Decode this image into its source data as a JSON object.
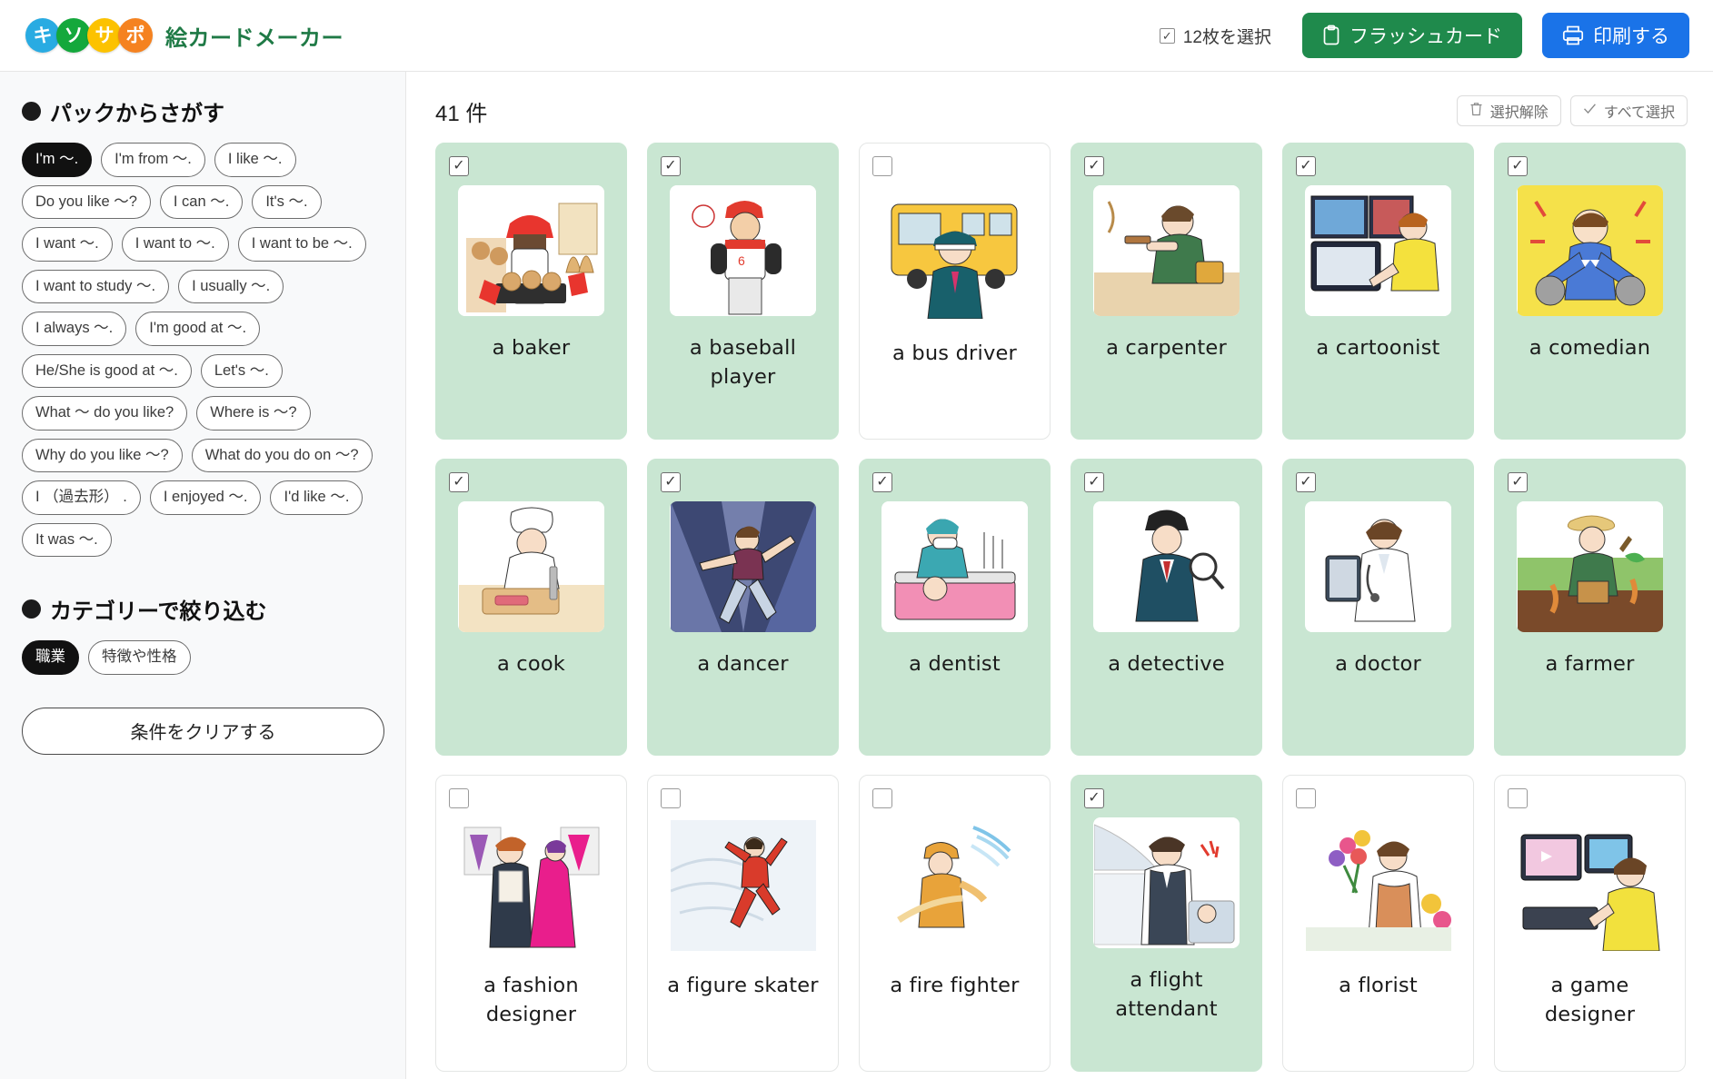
{
  "header": {
    "logo_letters": [
      "キ",
      "ソ",
      "サ",
      "ポ"
    ],
    "app_title": "絵カードメーカー",
    "selection_label": "12枚を選択",
    "selection_check_icon": "✓",
    "flashcard_button": "フラッシュカード",
    "print_button": "印刷する",
    "colors": {
      "logo_blue": "#29abe2",
      "logo_green": "#14a83c",
      "logo_yellow": "#fcc200",
      "logo_orange": "#f58220",
      "title_green": "#1f7a46",
      "flashcard_green": "#1f8a4c",
      "print_blue": "#1a73e8"
    }
  },
  "sidebar": {
    "pack_heading": "パックからさがす",
    "pack_tags": [
      {
        "label": "I'm 〜.",
        "active": true
      },
      {
        "label": "I'm from 〜.",
        "active": false
      },
      {
        "label": "I like 〜.",
        "active": false
      },
      {
        "label": "Do you like 〜?",
        "active": false
      },
      {
        "label": "I can 〜.",
        "active": false
      },
      {
        "label": "It's 〜.",
        "active": false
      },
      {
        "label": "I want 〜.",
        "active": false
      },
      {
        "label": "I want to 〜.",
        "active": false
      },
      {
        "label": "I want to be 〜.",
        "active": false
      },
      {
        "label": "I want to study 〜.",
        "active": false
      },
      {
        "label": "I usually 〜.",
        "active": false
      },
      {
        "label": "I always 〜.",
        "active": false
      },
      {
        "label": "I'm good at 〜.",
        "active": false
      },
      {
        "label": "He/She is good at 〜.",
        "active": false
      },
      {
        "label": "Let's 〜.",
        "active": false
      },
      {
        "label": "What 〜 do you like?",
        "active": false
      },
      {
        "label": "Where is 〜?",
        "active": false
      },
      {
        "label": "Why do you like 〜?",
        "active": false
      },
      {
        "label": "What do you do on 〜?",
        "active": false
      },
      {
        "label": "I （過去形） .",
        "active": false
      },
      {
        "label": "I enjoyed 〜.",
        "active": false
      },
      {
        "label": "I'd like 〜.",
        "active": false
      },
      {
        "label": "It was 〜.",
        "active": false
      }
    ],
    "category_heading": "カテゴリーで絞り込む",
    "category_tags": [
      {
        "label": "職業",
        "active": true
      },
      {
        "label": "特徴や性格",
        "active": false
      }
    ],
    "clear_button": "条件をクリアする"
  },
  "main": {
    "result_count": "41 件",
    "deselect_button": "選択解除",
    "deselect_icon": "trash-icon",
    "select_all_button": "すべて選択",
    "select_all_icon": "check-icon",
    "cards": [
      {
        "label": "a baker",
        "selected": true,
        "art": "baker"
      },
      {
        "label": "a baseball player",
        "selected": true,
        "art": "baseball"
      },
      {
        "label": "a bus driver",
        "selected": false,
        "art": "busdriver"
      },
      {
        "label": "a carpenter",
        "selected": true,
        "art": "carpenter"
      },
      {
        "label": "a cartoonist",
        "selected": true,
        "art": "cartoonist"
      },
      {
        "label": "a comedian",
        "selected": true,
        "art": "comedian"
      },
      {
        "label": "a cook",
        "selected": true,
        "art": "cook"
      },
      {
        "label": "a dancer",
        "selected": true,
        "art": "dancer"
      },
      {
        "label": "a dentist",
        "selected": true,
        "art": "dentist"
      },
      {
        "label": "a detective",
        "selected": true,
        "art": "detective"
      },
      {
        "label": "a doctor",
        "selected": true,
        "art": "doctor"
      },
      {
        "label": "a farmer",
        "selected": true,
        "art": "farmer"
      },
      {
        "label": "a fashion designer",
        "selected": false,
        "art": "fashion"
      },
      {
        "label": "a figure skater",
        "selected": false,
        "art": "skater"
      },
      {
        "label": "a fire fighter",
        "selected": false,
        "art": "firefighter"
      },
      {
        "label": "a flight attendant",
        "selected": true,
        "art": "flight"
      },
      {
        "label": "a florist",
        "selected": false,
        "art": "florist"
      },
      {
        "label": "a game designer",
        "selected": false,
        "art": "gamedesigner"
      }
    ],
    "card_selected_color": "#c9e6d2"
  }
}
